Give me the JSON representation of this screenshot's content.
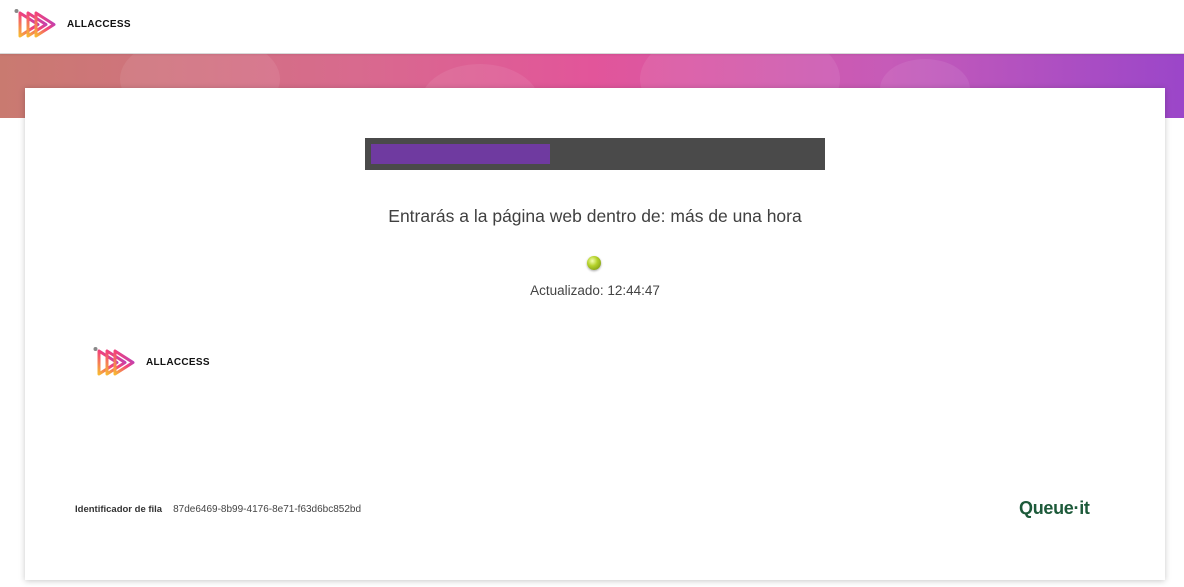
{
  "header": {
    "brand": "ALLACCESS"
  },
  "card": {
    "progress": 0.4,
    "wait_message": "Entrarás a la página web dentro de: más de una hora",
    "updated_text": "Actualizado: 12:44:47",
    "brand": "ALLACCESS",
    "queue_id_label": "Identificador de fila",
    "queue_id_value": "87de6469-8b99-4176-8e71-f63d6bc852bd",
    "powered_by": "Queue·it"
  },
  "colors": {
    "progress_track": "#4a4a4a",
    "progress_fill": "#6f3aa0",
    "status_dot": "#9dbd1c",
    "queueit_green": "#1d5a3a"
  },
  "icons": {
    "brand_logo": "allaccess-logo-icon",
    "status": "status-dot-icon"
  }
}
